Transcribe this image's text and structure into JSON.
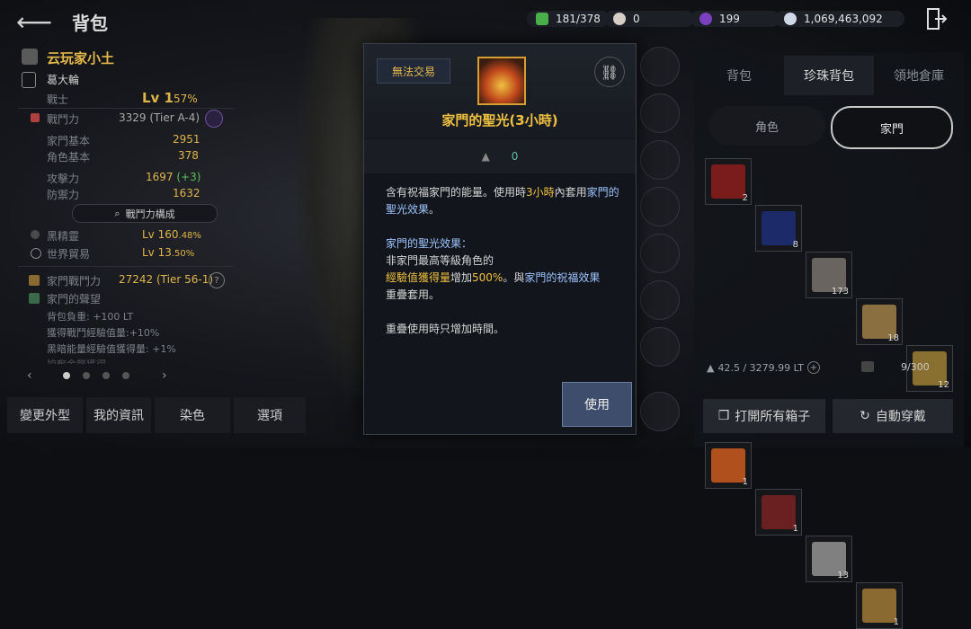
{
  "header": {
    "title": "背包",
    "currencies": [
      {
        "icon": "green-gem-icon",
        "value": "181/378"
      },
      {
        "icon": "pearl-icon",
        "value": "0"
      },
      {
        "icon": "purple-orb-icon",
        "value": "199"
      },
      {
        "icon": "silver-coin-icon",
        "value": "1,069,463,092"
      }
    ]
  },
  "character": {
    "name": "云玩家小土",
    "guild": "葛大輪",
    "class": "戰士",
    "level": "Lv 1",
    "level_pct": "57%",
    "combat_power_label": "戰鬥力",
    "combat_power": "3329 (Tier A-4)",
    "family_base_label": "家門基本",
    "family_base": "2951",
    "char_base_label": "角色基本",
    "char_base": "378",
    "attack_label": "攻擊力",
    "attack": "1697",
    "attack_bonus": "(+3)",
    "defense_label": "防禦力",
    "defense": "1632",
    "composition_button": "戰鬥力構成",
    "dark_label": "黑精靈",
    "dark_level": "Lv 160",
    "dark_pct": ".48%",
    "trade_label": "世界貿易",
    "trade_level": "Lv 13",
    "trade_pct": ".50%",
    "family_power_label": "家門戰鬥力",
    "family_power": "27242 (Tier 56-1)",
    "fame_label": "家門的聲望",
    "fame_items": [
      "背包負重: +100 LT",
      "獲得戰鬥經驗值量:+10%",
      "黑暗能量經驗值獲得量: +1%",
      "掠奪金幣獲得…"
    ]
  },
  "bottom_tabs": [
    "變更外型",
    "我的資訊",
    "染色",
    "選項"
  ],
  "inventory": {
    "tabs": [
      "背包",
      "珍珠背包",
      "領地倉庫"
    ],
    "active_tab": "珍珠背包",
    "sub_tabs": [
      "角色",
      "家門"
    ],
    "active_sub_tab": "家門",
    "slots": [
      {
        "count": "2",
        "color": "#7a1c1c"
      },
      {
        "count": "8",
        "color": "#1c2a6a"
      },
      {
        "count": "173",
        "color": "#6a6460"
      },
      {
        "count": "18",
        "color": "#8a7040"
      },
      {
        "count": "12",
        "color": "#8a7030"
      },
      {
        "count": "1",
        "color": "#b0501c"
      },
      {
        "count": "1",
        "color": "#6a2020"
      },
      {
        "count": "13",
        "color": "#808080"
      },
      {
        "count": "1",
        "color": "#8a6a30"
      }
    ],
    "weight": "42.5 / 3279.99 LT",
    "capacity": "9/300",
    "open_all_button": "打開所有箱子",
    "auto_equip_button": "自動穿戴"
  },
  "tooltip": {
    "tag": "無法交易",
    "title": "家門的聖光(3小時)",
    "weight": "0",
    "desc_1a": "含有祝福家門的能量。使用時",
    "desc_1b": "3小時",
    "desc_1c": "內套用",
    "desc_1d": "家門的聖光效果",
    "desc_1e": "。",
    "desc_2": "家門的聖光效果：",
    "desc_3": "非家門最高等級角色的",
    "desc_4a": "經驗值獲得量",
    "desc_4b": "增加",
    "desc_4c": "500%",
    "desc_4d": "。與",
    "desc_4e": "家門的祝福效果",
    "desc_5": "重疊套用。",
    "desc_6": "重疊使用時只增加時間。",
    "use_button": "使用"
  }
}
